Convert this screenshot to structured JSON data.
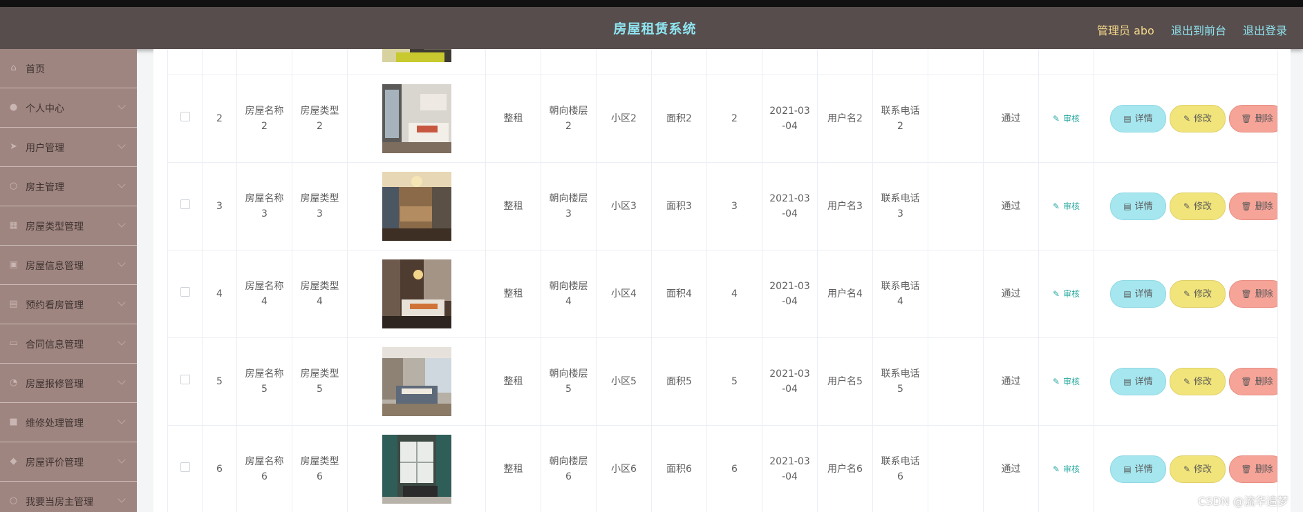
{
  "header": {
    "title": "房屋租赁系统",
    "admin_label": "管理员 abo",
    "nav_front": "退出到前台",
    "nav_logout": "退出登录"
  },
  "sidebar": {
    "items": [
      {
        "label": "首页",
        "icon": "home-icon"
      },
      {
        "label": "个人中心",
        "icon": "user-icon"
      },
      {
        "label": "用户管理",
        "icon": "send-icon"
      },
      {
        "label": "房主管理",
        "icon": "circle-icon"
      },
      {
        "label": "房屋类型管理",
        "icon": "grid-icon"
      },
      {
        "label": "房屋信息管理",
        "icon": "building-icon"
      },
      {
        "label": "预约看房管理",
        "icon": "calendar-icon"
      },
      {
        "label": "合同信息管理",
        "icon": "document-icon"
      },
      {
        "label": "房屋报修管理",
        "icon": "wrench-icon"
      },
      {
        "label": "维修处理管理",
        "icon": "tool-icon"
      },
      {
        "label": "房屋评价管理",
        "icon": "location-icon"
      },
      {
        "label": "我要当房主管理",
        "icon": "key-icon"
      }
    ]
  },
  "table": {
    "audit_label": "审核",
    "detail_label": "详情",
    "edit_label": "修改",
    "delete_label": "删除",
    "rows": [
      {
        "idx": "2",
        "name": "房屋名称\n2",
        "type": "房屋类型\n2",
        "rent": "整租",
        "floor": "朝向楼层\n2",
        "community": "小区2",
        "area": "面积2",
        "num": "2",
        "date": "2021-03\n-04",
        "user": "用户名2",
        "phone": "联系电话\n2",
        "status": "通过"
      },
      {
        "idx": "3",
        "name": "房屋名称\n3",
        "type": "房屋类型\n3",
        "rent": "整租",
        "floor": "朝向楼层\n3",
        "community": "小区3",
        "area": "面积3",
        "num": "3",
        "date": "2021-03\n-04",
        "user": "用户名3",
        "phone": "联系电话\n3",
        "status": "通过"
      },
      {
        "idx": "4",
        "name": "房屋名称\n4",
        "type": "房屋类型\n4",
        "rent": "整租",
        "floor": "朝向楼层\n4",
        "community": "小区4",
        "area": "面积4",
        "num": "4",
        "date": "2021-03\n-04",
        "user": "用户名4",
        "phone": "联系电话\n4",
        "status": "通过"
      },
      {
        "idx": "5",
        "name": "房屋名称\n5",
        "type": "房屋类型\n5",
        "rent": "整租",
        "floor": "朝向楼层\n5",
        "community": "小区5",
        "area": "面积5",
        "num": "5",
        "date": "2021-03\n-04",
        "user": "用户名5",
        "phone": "联系电话\n5",
        "status": "通过"
      },
      {
        "idx": "6",
        "name": "房屋名称\n6",
        "type": "房屋类型\n6",
        "rent": "整租",
        "floor": "朝向楼层\n6",
        "community": "小区6",
        "area": "面积6",
        "num": "6",
        "date": "2021-03\n-04",
        "user": "用户名6",
        "phone": "联系电话\n6",
        "status": "通过"
      }
    ]
  },
  "watermark": "CSDN @流华追梦",
  "colors": {
    "header_bg": "#574d4c",
    "title": "#8fe6f2",
    "admin": "#f3d78a",
    "sidebar_bg": "#9f8580",
    "detail_btn": "#a5e6ef",
    "edit_btn": "#f1e47a",
    "delete_btn": "#f6a398",
    "audit": "#2aa9a0"
  }
}
